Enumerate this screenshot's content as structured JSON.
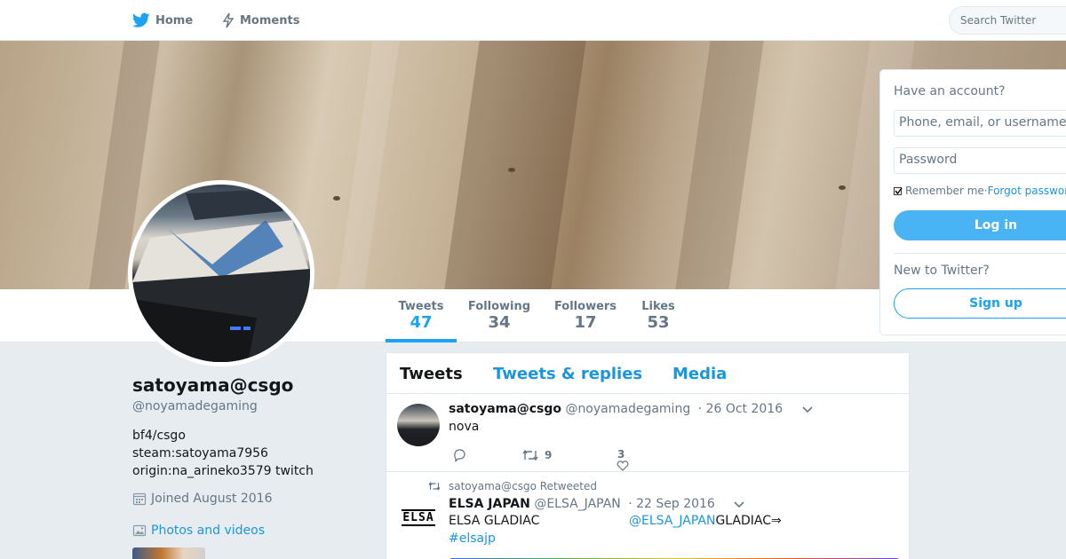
{
  "nav": {
    "home_label": "Home",
    "moments_label": "Moments",
    "search_placeholder": "Search Twitter"
  },
  "stats": [
    {
      "label": "Tweets",
      "value": "47"
    },
    {
      "label": "Following",
      "value": "34"
    },
    {
      "label": "Followers",
      "value": "17"
    },
    {
      "label": "Likes",
      "value": "53"
    }
  ],
  "profile": {
    "name": "satoyama@csgo",
    "handle": "@noyamadegaming",
    "bio": [
      "bf4/csgo",
      "steam:satoyama7956",
      "origin:na_arineko3579 twitch"
    ],
    "joined": "Joined August 2016",
    "photos_label": "Photos and videos"
  },
  "timeline": {
    "tabs": [
      "Tweets",
      "Tweets & replies",
      "Media"
    ],
    "tweets": [
      {
        "name": "satoyama@csgo",
        "handle": "@noyamadegaming",
        "date": "· 26 Oct 2016",
        "text": "nova",
        "retweets": "9",
        "likes": "3"
      },
      {
        "context": "satoyama@csgo Retweeted",
        "name": "ELSA JAPAN",
        "handle": "@ELSA_JAPAN",
        "date": "· 22 Sep 2016",
        "text_col1": "ELSA GLADIAC",
        "mention": "@ELSA_JAPAN",
        "text_col2": "GLADIAC⇒",
        "hashtag": "#elsajp",
        "avatar_text": "ELSA"
      }
    ]
  },
  "login": {
    "header": "Have an account?",
    "username_placeholder": "Phone, email, or username",
    "password_placeholder": "Password",
    "remember": "Remember me",
    "separator": " · ",
    "forgot": "Forgot password?",
    "login_button": "Log in",
    "new_question": "New to Twitter?",
    "signup_button": "Sign up"
  },
  "colors": {
    "accent": "#1da1f2",
    "link": "#1b95e0",
    "muted": "#657786"
  }
}
